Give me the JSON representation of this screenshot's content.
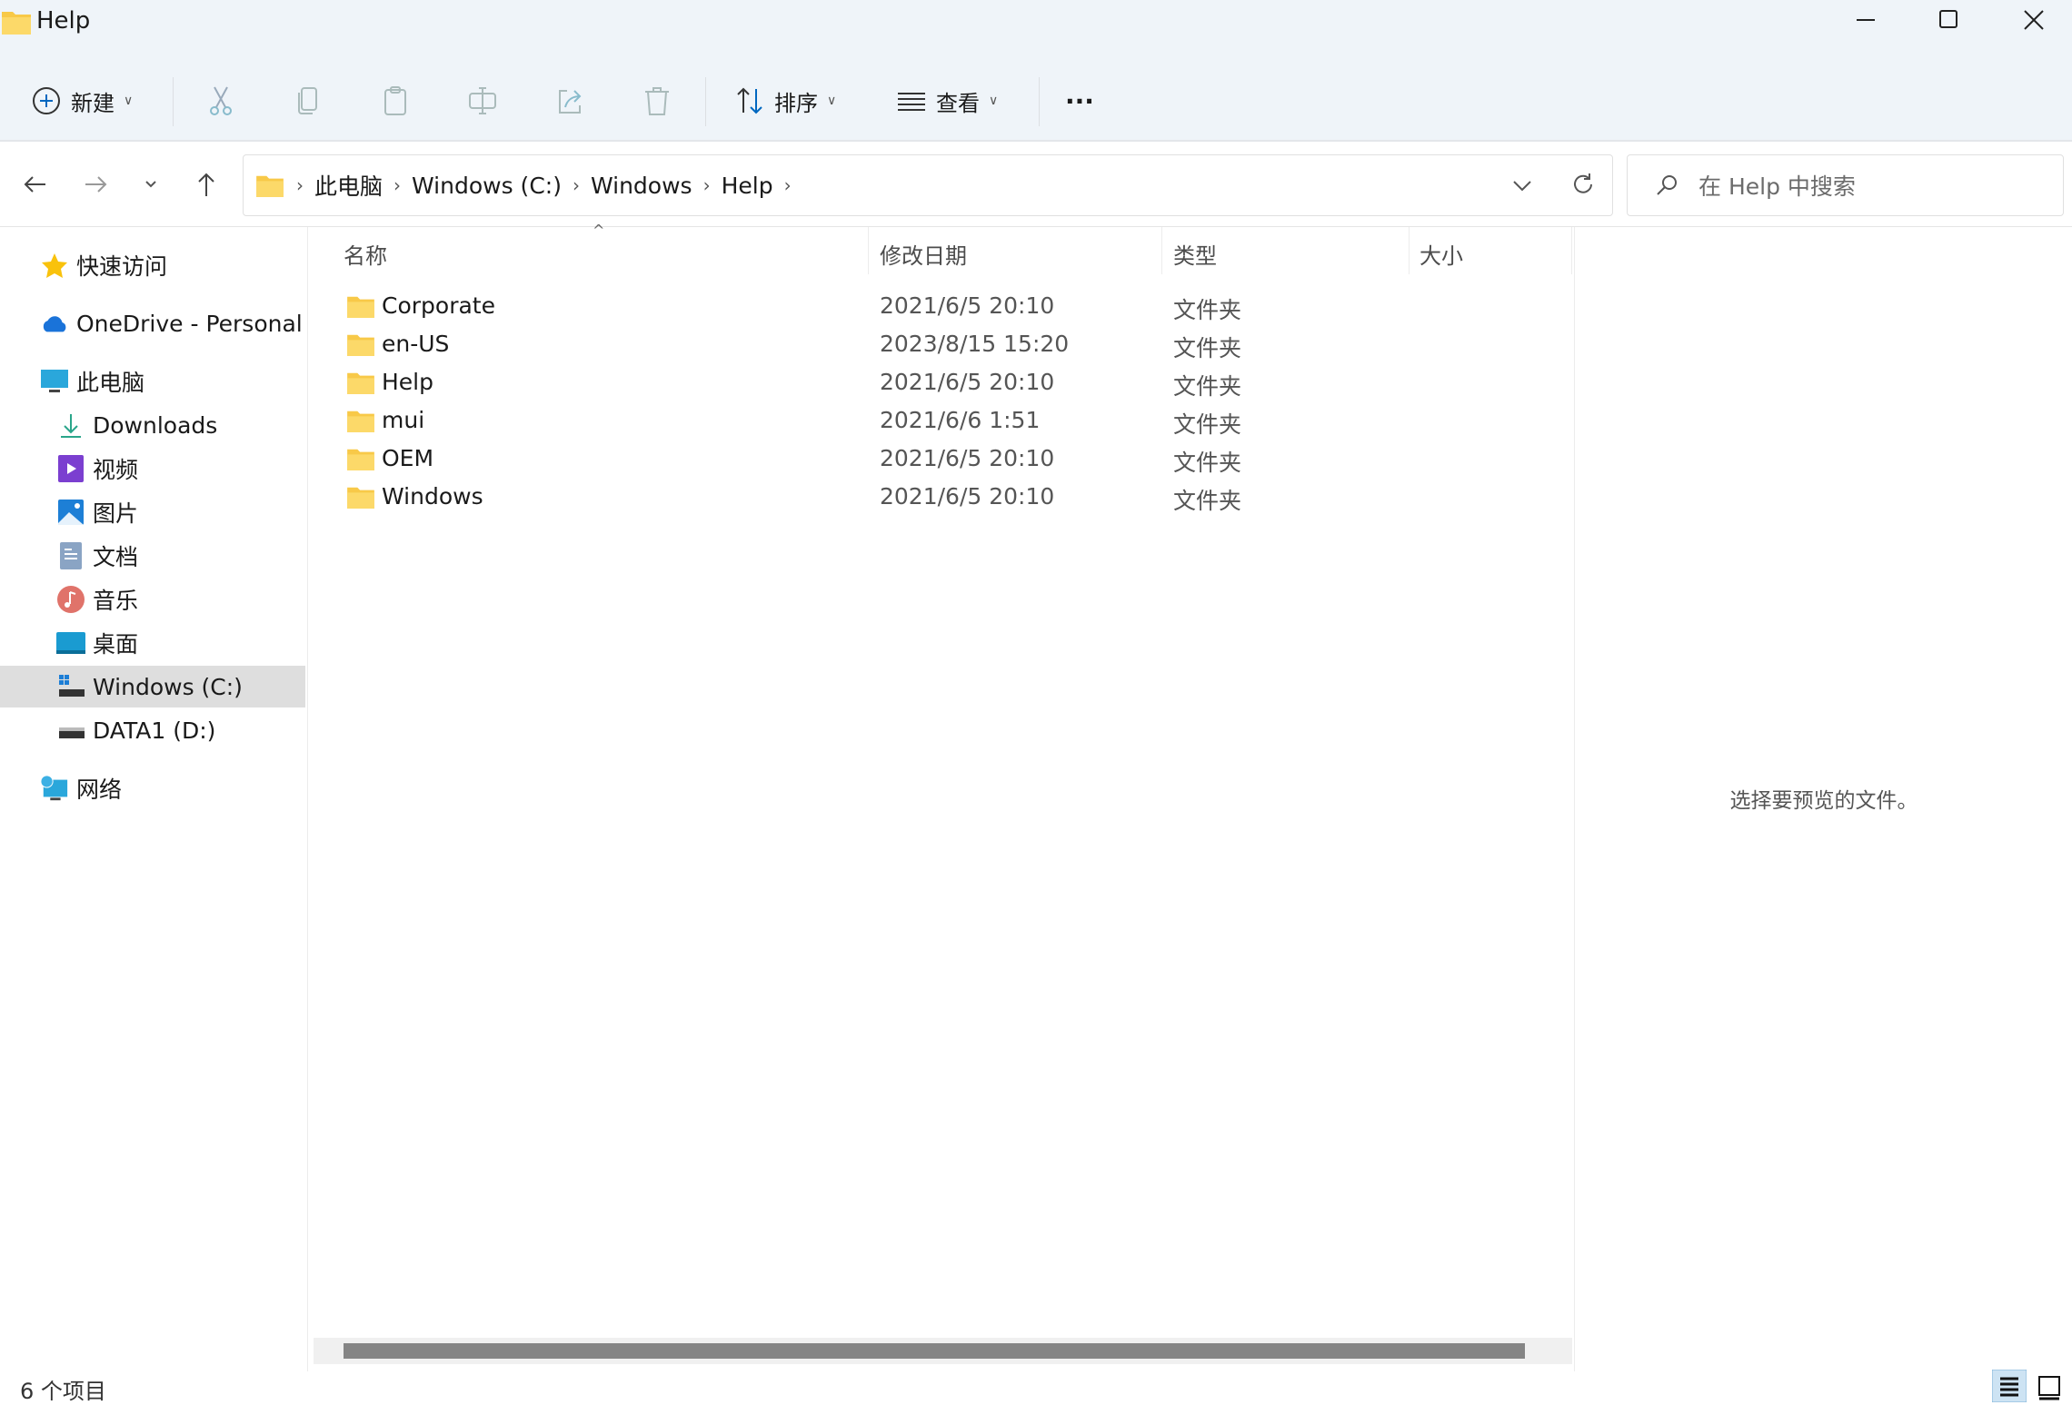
{
  "window": {
    "title": "Help",
    "icon": "folder-icon",
    "controls": [
      "minimize",
      "maximize",
      "close"
    ]
  },
  "toolbar": {
    "new_label": "新建",
    "sort_label": "排序",
    "view_label": "查看",
    "more_label": "···",
    "actions": [
      "cut",
      "copy",
      "paste",
      "rename",
      "share",
      "delete"
    ]
  },
  "nav": {
    "back": "back-arrow",
    "forward": "forward-arrow",
    "recent": "chevron-down",
    "up": "up-arrow"
  },
  "address": {
    "crumbs": [
      "此电脑",
      "Windows (C:)",
      "Windows",
      "Help"
    ]
  },
  "search": {
    "placeholder": "在 Help 中搜索"
  },
  "sidebar": {
    "items": [
      {
        "label": "快速访问",
        "icon": "star-icon"
      },
      {
        "label": "OneDrive - Personal",
        "icon": "cloud-icon"
      },
      {
        "label": "此电脑",
        "icon": "computer-icon"
      },
      {
        "label": "Downloads",
        "icon": "download-icon"
      },
      {
        "label": "视频",
        "icon": "video-icon"
      },
      {
        "label": "图片",
        "icon": "pictures-icon"
      },
      {
        "label": "文档",
        "icon": "documents-icon"
      },
      {
        "label": "音乐",
        "icon": "music-icon"
      },
      {
        "label": "桌面",
        "icon": "desktop-icon"
      },
      {
        "label": "Windows (C:)",
        "icon": "drive-c-icon",
        "selected": true
      },
      {
        "label": "DATA1 (D:)",
        "icon": "drive-icon"
      },
      {
        "label": "网络",
        "icon": "network-icon"
      }
    ]
  },
  "list": {
    "columns": [
      "名称",
      "修改日期",
      "类型",
      "大小"
    ],
    "rows": [
      {
        "name": "Corporate",
        "date": "2021/6/5 20:10",
        "type": "文件夹"
      },
      {
        "name": "en-US",
        "date": "2023/8/15 15:20",
        "type": "文件夹"
      },
      {
        "name": "Help",
        "date": "2021/6/5 20:10",
        "type": "文件夹"
      },
      {
        "name": "mui",
        "date": "2021/6/6 1:51",
        "type": "文件夹"
      },
      {
        "name": "OEM",
        "date": "2021/6/5 20:10",
        "type": "文件夹"
      },
      {
        "name": "Windows",
        "date": "2021/6/5 20:10",
        "type": "文件夹"
      }
    ]
  },
  "preview": {
    "message": "选择要预览的文件。"
  },
  "status": {
    "count": "6 个项目"
  },
  "colors": {
    "chrome": "#eff4f9",
    "accent": "#0067c0",
    "folder": "#f8c948",
    "selected": "#dedede"
  }
}
